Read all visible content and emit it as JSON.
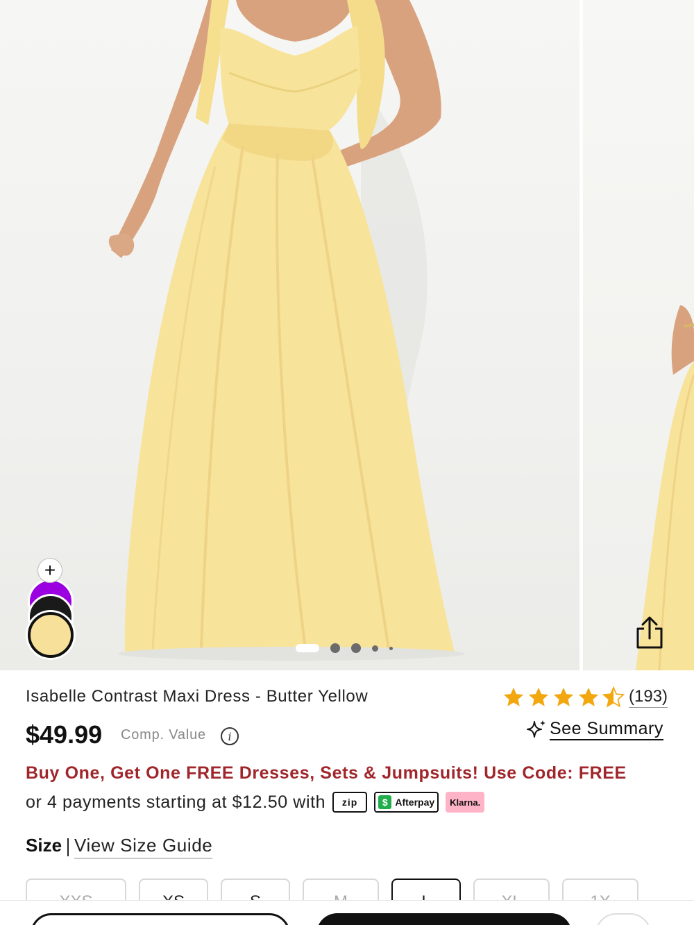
{
  "product": {
    "title": "Isabelle Contrast Maxi Dress - Butter Yellow",
    "price": "$49.99",
    "comp_value_label": "Comp. Value",
    "info_glyph": "i",
    "rating_value": 4.5,
    "review_count": "(193)",
    "see_summary_label": "See Summary"
  },
  "promo": {
    "text": "Buy One, Get One FREE Dresses, Sets & Jumpsuits! Use Code: FREE",
    "color": "#a0262b"
  },
  "payments": {
    "text": "or 4 payments starting at $12.50 with",
    "zip_label": "zip",
    "afterpay_label": "Afterpay",
    "klarna_label": "Klarna."
  },
  "size": {
    "label": "Size",
    "guide_link": "View Size Guide",
    "options": [
      "XXS",
      "XS",
      "S",
      "M",
      "L",
      "XL",
      "1X"
    ]
  },
  "gallery": {
    "swatch_add": "+",
    "swatches": [
      {
        "name": "purple",
        "color": "#9a00e0"
      },
      {
        "name": "black",
        "color": "#1a1a1a"
      },
      {
        "name": "butter-yellow",
        "color": "#f6e09a",
        "selected": true
      }
    ],
    "dot_count": 5,
    "active_dot": 0,
    "icons": {
      "share": "share-icon",
      "sparkle": "sparkle-icon"
    }
  },
  "colors": {
    "star": "#f3a70f",
    "dress": "#f8e39a"
  }
}
